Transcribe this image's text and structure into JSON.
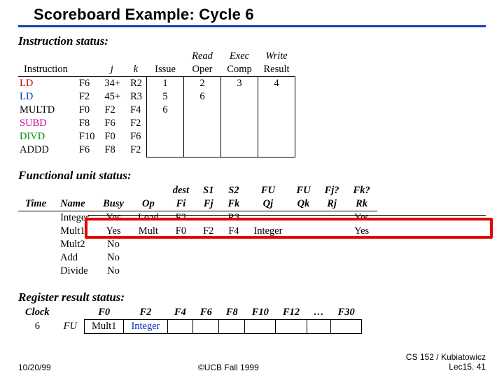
{
  "title": "Scoreboard Example: Cycle 6",
  "instr": {
    "section": "Instruction status:",
    "head_top": {
      "read": "Read",
      "exec": "Exec",
      "write": "Write"
    },
    "head": {
      "instr": "Instruction",
      "j": "j",
      "k": "k",
      "issue": "Issue",
      "oper": "Oper",
      "comp": "Comp",
      "result": "Result"
    },
    "rows": [
      {
        "cls": "red",
        "op": "LD",
        "dest": "F6",
        "j": "34+",
        "k": "R2",
        "issue": "1",
        "oper": "2",
        "comp": "3",
        "res": "4"
      },
      {
        "cls": "blue",
        "op": "LD",
        "dest": "F2",
        "j": "45+",
        "k": "R3",
        "issue": "5",
        "oper": "6",
        "comp": "",
        "res": ""
      },
      {
        "cls": "",
        "op": "MULTD",
        "dest": "F0",
        "j": "F2",
        "k": "F4",
        "issue": "6",
        "oper": "",
        "comp": "",
        "res": ""
      },
      {
        "cls": "pink",
        "op": "SUBD",
        "dest": "F8",
        "j": "F6",
        "k": "F2",
        "issue": "",
        "oper": "",
        "comp": "",
        "res": ""
      },
      {
        "cls": "green",
        "op": "DIVD",
        "dest": "F10",
        "j": "F0",
        "k": "F6",
        "issue": "",
        "oper": "",
        "comp": "",
        "res": ""
      },
      {
        "cls": "",
        "op": "ADDD",
        "dest": "F6",
        "j": "F8",
        "k": "F2",
        "issue": "",
        "oper": "",
        "comp": "",
        "res": ""
      }
    ]
  },
  "fu": {
    "section": "Functional unit status:",
    "head_top": {
      "dest": "dest",
      "s1": "S1",
      "s2": "S2",
      "fu1": "FU",
      "fu2": "FU",
      "fj": "Fj?",
      "fk": "Fk?"
    },
    "head": {
      "time": "Time",
      "name": "Name",
      "busy": "Busy",
      "op": "Op",
      "fi": "Fi",
      "fj": "Fj",
      "fk": "Fk",
      "qj": "Qj",
      "qk": "Qk",
      "rj": "Rj",
      "rk": "Rk"
    },
    "rows": [
      {
        "name": "Integer",
        "busy": "Yes",
        "op": "Load",
        "fi": "F2",
        "fj": "",
        "fk": "R3",
        "qj": "",
        "qk": "",
        "rj": "",
        "rk": "Yes",
        "struck": true
      },
      {
        "name": "Mult1",
        "busy": "Yes",
        "op": "Mult",
        "fi": "F0",
        "fj": "F2",
        "fk": "F4",
        "qj": "Integer",
        "qk": "",
        "rj": "",
        "rk": "Yes",
        "highlight": true
      },
      {
        "name": "Mult2",
        "busy": "No",
        "op": "",
        "fi": "",
        "fj": "",
        "fk": "",
        "qj": "",
        "qk": "",
        "rj": "",
        "rk": ""
      },
      {
        "name": "Add",
        "busy": "No",
        "op": "",
        "fi": "",
        "fj": "",
        "fk": "",
        "qj": "",
        "qk": "",
        "rj": "",
        "rk": ""
      },
      {
        "name": "Divide",
        "busy": "No",
        "op": "",
        "fi": "",
        "fj": "",
        "fk": "",
        "qj": "",
        "qk": "",
        "rj": "",
        "rk": ""
      }
    ]
  },
  "regres": {
    "section": "Register result status:",
    "clock_label": "Clock",
    "fu_label": "FU",
    "clock": "6",
    "cols": [
      "F0",
      "F2",
      "F4",
      "F6",
      "F8",
      "F10",
      "F12",
      "…",
      "F30"
    ],
    "vals": [
      "Mult1",
      "Integer",
      "",
      "",
      "",
      "",
      "",
      "",
      ""
    ]
  },
  "footer": {
    "left": "10/20/99",
    "center": "©UCB Fall 1999",
    "right1": "CS 152 / Kubiatowicz",
    "right2": "Lec15. 41"
  }
}
